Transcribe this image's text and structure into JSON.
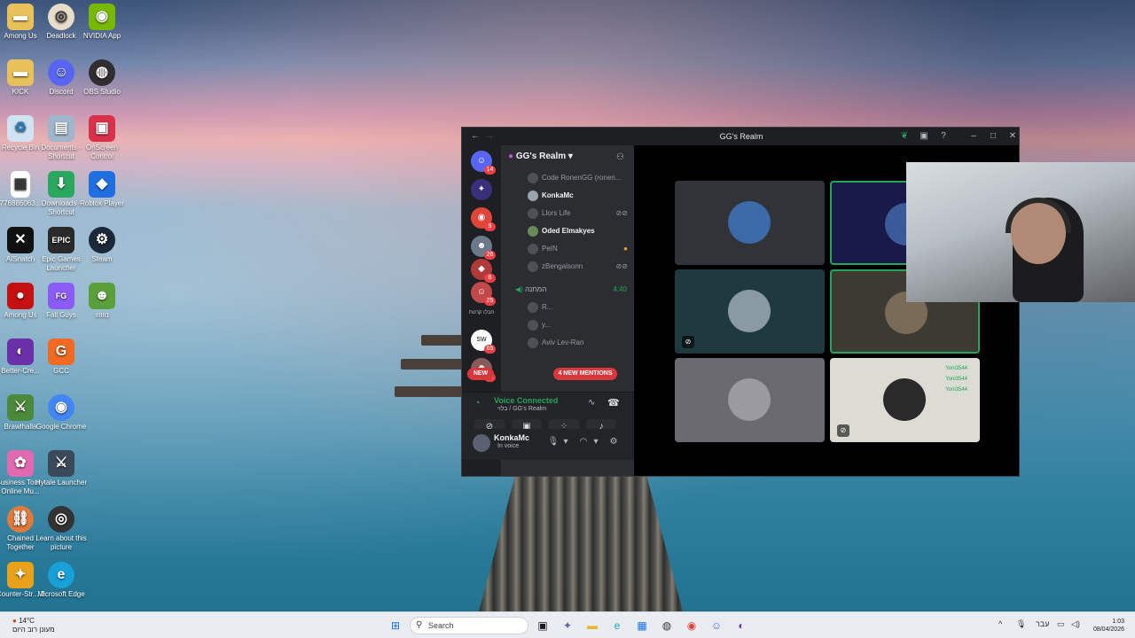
{
  "desktop": {
    "icons": [
      {
        "label": "Among Us",
        "icon": "folder-icon",
        "color": "#e8c15a"
      },
      {
        "label": "Deadlock",
        "icon": "deadlock-icon",
        "color": "#e8dccb"
      },
      {
        "label": "NVIDIA App",
        "icon": "nvidia-icon",
        "color": "#76b900"
      },
      {
        "label": "KICK",
        "icon": "folder-icon",
        "color": "#e8c15a"
      },
      {
        "label": "Discord",
        "icon": "discord-icon",
        "color": "#5865f2"
      },
      {
        "label": "OBS Studio",
        "icon": "obs-icon",
        "color": "#302e31"
      },
      {
        "label": "Recycle Bin",
        "icon": "recycle-bin-icon",
        "color": "#cfe3f2"
      },
      {
        "label": "Documents - Shortcut",
        "icon": "documents-icon",
        "color": "#9fb6cc"
      },
      {
        "label": "OnScreen Control",
        "icon": "onscreen-control-icon",
        "color": "#d8324a"
      },
      {
        "label": "776886063...",
        "icon": "qr-file-icon",
        "color": "#ffffff"
      },
      {
        "label": "Downloads - Shortcut",
        "icon": "downloads-icon",
        "color": "#2aa860"
      },
      {
        "label": "Roblox Player",
        "icon": "roblox-icon",
        "color": "#1f6fe0"
      },
      {
        "label": "AISnatch",
        "icon": "aisnatch-icon",
        "color": "#111111"
      },
      {
        "label": "Epic Games Launcher",
        "icon": "epic-games-icon",
        "color": "#2a2a2a"
      },
      {
        "label": "Steam",
        "icon": "steam-icon",
        "color": "#1b2838"
      },
      {
        "label": "Among Us",
        "icon": "among-us-icon",
        "color": "#c51111"
      },
      {
        "label": "Fall Guys",
        "icon": "fall-guys-icon",
        "color": "#8a5cf5"
      },
      {
        "label": "נוווווו",
        "icon": "game-icon",
        "color": "#5aa03a"
      },
      {
        "label": "Better-Cre...",
        "icon": "better-crewlink-icon",
        "color": "#6b2fa8"
      },
      {
        "label": "GCC",
        "icon": "gcc-icon",
        "color": "#f06a23"
      },
      {
        "label": "Brawlhalla",
        "icon": "brawlhalla-icon",
        "color": "#4b8a3a"
      },
      {
        "label": "Google Chrome",
        "icon": "chrome-icon",
        "color": "#4285f4"
      },
      {
        "label": "Business Tour - Online Mu...",
        "icon": "business-tour-icon",
        "color": "#e06ab0"
      },
      {
        "label": "Hytale Launcher",
        "icon": "hytale-icon",
        "color": "#3a4a5a"
      },
      {
        "label": "Chained Together",
        "icon": "chained-together-icon",
        "color": "#e07a3a"
      },
      {
        "label": "Learn about this picture",
        "icon": "camera-icon",
        "color": "#333333"
      },
      {
        "label": "Counter-Str... 2",
        "icon": "counter-strike-icon",
        "color": "#e8a21a"
      },
      {
        "label": "Microsoft Edge",
        "icon": "edge-icon",
        "color": "#1aa0d8"
      }
    ]
  },
  "discord": {
    "window_title": "GG's Realm",
    "server_name": "GG's Realm",
    "rail_badges": [
      "14",
      "9",
      "26",
      "8",
      "25",
      "65",
      "56"
    ],
    "rail_label_hebrew": "חבלו קרנות",
    "members": [
      {
        "name": "Code RonenGG (ronen...",
        "active": false
      },
      {
        "name": "KonkaMc",
        "active": true
      },
      {
        "name": "Llors Life",
        "active": false
      },
      {
        "name": "Oded Elmakyes",
        "active": true
      },
      {
        "name": "PeIN",
        "active": false
      },
      {
        "name": "zBengalsonn",
        "active": false
      }
    ],
    "channel2": {
      "name": "המתנה",
      "time": "4:40"
    },
    "channel2_members": [
      "R...",
      "y...",
      "Aviv Lev-Ran"
    ],
    "mentions_label": "4 NEW MENTIONS",
    "new_label": "NEW",
    "voice": {
      "status": "Voice Connected",
      "channel": "בלוי / GG's Realm"
    },
    "user": {
      "name": "KonkaMc",
      "status": "In voice"
    },
    "tile_names": [
      "Yoni3544",
      "Yoni3544",
      "Yoni3544"
    ]
  },
  "taskbar": {
    "weather_temp": "14°C",
    "weather_desc": "מעונן רוב היום",
    "search_placeholder": "Search",
    "lang": "עבר",
    "time": "1:03",
    "date": "08/04/2026"
  },
  "colors": {
    "discord_bg": "#1e1f22",
    "discord_panel": "#2b2d31",
    "voice_green": "#23a55a",
    "mention_red": "#da373c",
    "blurple": "#5865f2"
  }
}
